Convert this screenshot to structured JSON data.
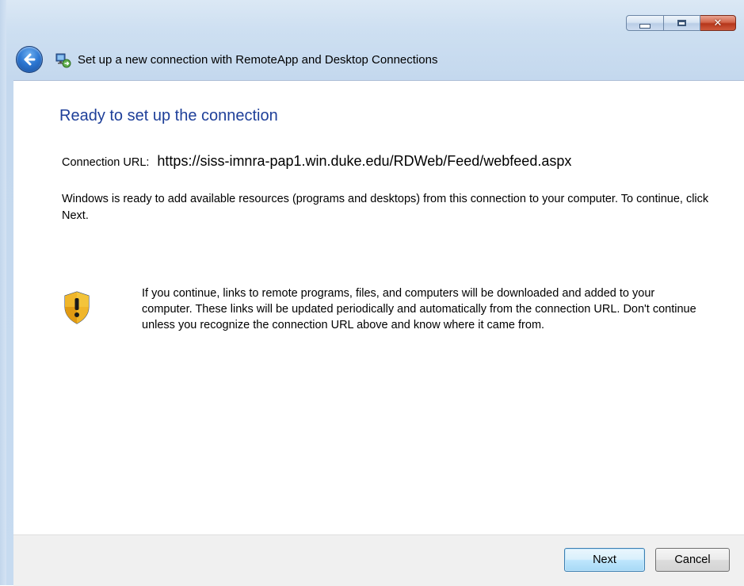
{
  "window": {
    "title": "Set up a new connection with RemoteApp and Desktop Connections",
    "caption_buttons": {
      "minimize": "minimize-icon",
      "maximize": "maximize-icon",
      "close": "close-icon"
    }
  },
  "nav": {
    "back_icon": "back-arrow-icon",
    "app_icon": "remoteapp-connection-icon"
  },
  "main": {
    "heading": "Ready to set up the connection",
    "connection_url_label": "Connection URL:",
    "connection_url_value": "https://siss-imnra-pap1.win.duke.edu/RDWeb/Feed/webfeed.aspx",
    "description": "Windows is ready to add available resources (programs and desktops) from this connection to your computer. To continue, click Next.",
    "warning_icon": "security-shield-icon",
    "warning_text": "If you continue, links to remote programs, files, and computers will be downloaded and added to your computer.  These links will be updated periodically and automatically from the connection URL. Don't continue unless you recognize the connection URL above and know where it came from."
  },
  "footer": {
    "next_label": "Next",
    "cancel_label": "Cancel"
  },
  "colors": {
    "heading": "#1e3f99",
    "frame": "#c7dbf0",
    "close_button": "#c9452a"
  }
}
